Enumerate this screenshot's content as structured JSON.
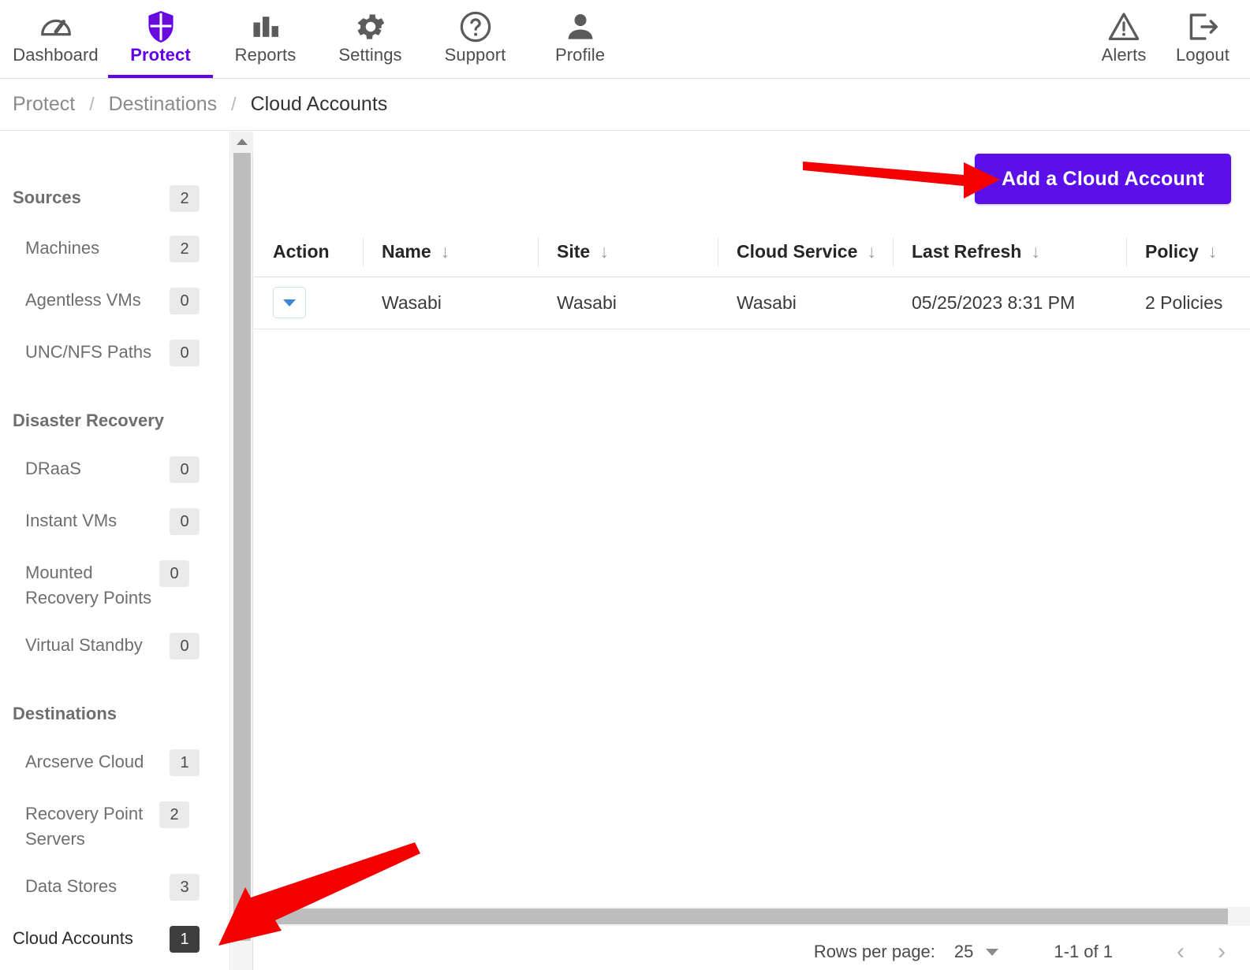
{
  "topnav": {
    "items": [
      {
        "label": "Dashboard",
        "icon": "gauge-icon",
        "active": false
      },
      {
        "label": "Protect",
        "icon": "shield-icon",
        "active": true
      },
      {
        "label": "Reports",
        "icon": "bar-chart-icon",
        "active": false
      },
      {
        "label": "Settings",
        "icon": "gear-icon",
        "active": false
      },
      {
        "label": "Support",
        "icon": "question-circle-icon",
        "active": false
      },
      {
        "label": "Profile",
        "icon": "person-icon",
        "active": false
      }
    ],
    "right_items": [
      {
        "label": "Alerts",
        "icon": "warning-triangle-icon"
      },
      {
        "label": "Logout",
        "icon": "logout-arrow-icon"
      }
    ],
    "active_color": "#6200ee"
  },
  "breadcrumb": {
    "items": [
      "Protect",
      "Destinations",
      "Cloud Accounts"
    ],
    "separator": "/",
    "current": "Cloud Accounts"
  },
  "sidebar": {
    "groups": [
      {
        "title": "Sources",
        "title_count": "2",
        "items": [
          {
            "label": "Machines",
            "count": "2",
            "selected": false
          },
          {
            "label": "Agentless VMs",
            "count": "0",
            "selected": false
          },
          {
            "label": "UNC/NFS Paths",
            "count": "0",
            "selected": false
          }
        ]
      },
      {
        "title": "Disaster Recovery",
        "title_count": "",
        "items": [
          {
            "label": "DRaaS",
            "count": "0",
            "selected": false
          },
          {
            "label": "Instant VMs",
            "count": "0",
            "selected": false
          },
          {
            "label": "Mounted Recovery Points",
            "count": "0",
            "selected": false
          },
          {
            "label": "Virtual Standby",
            "count": "0",
            "selected": false
          }
        ]
      },
      {
        "title": "Destinations",
        "title_count": "",
        "items": [
          {
            "label": "Arcserve Cloud",
            "count": "1",
            "selected": false
          },
          {
            "label": "Recovery Point Servers",
            "count": "2",
            "selected": false
          },
          {
            "label": "Data Stores",
            "count": "3",
            "selected": false
          },
          {
            "label": "Cloud Accounts",
            "count": "1",
            "selected": true
          }
        ]
      }
    ]
  },
  "main": {
    "add_button_label": "Add a Cloud Account",
    "add_button_color": "#5b10ea",
    "table": {
      "columns": [
        {
          "label": "Action",
          "sortable": false
        },
        {
          "label": "Name",
          "sortable": true,
          "sort_icon": "↓"
        },
        {
          "label": "Site",
          "sortable": true,
          "sort_icon": "↓"
        },
        {
          "label": "Cloud Service",
          "sortable": true,
          "sort_icon": "↓"
        },
        {
          "label": "Last Refresh",
          "sortable": true,
          "sort_icon": "↓"
        },
        {
          "label": "Policy",
          "sortable": true,
          "sort_icon": "↓"
        }
      ],
      "rows": [
        {
          "action": "row-action-dropdown",
          "name": "Wasabi",
          "site": "Wasabi",
          "cloud_service": "Wasabi",
          "last_refresh": "05/25/2023 8:31 PM",
          "policy": "2 Policies"
        }
      ]
    },
    "pagination": {
      "rows_per_page_label": "Rows per page:",
      "rows_per_page_value": "25",
      "range": "1-1 of 1",
      "prev_icon": "‹",
      "next_icon": "›"
    }
  },
  "annotations": {
    "arrow_color": "#f40000",
    "arrows": [
      {
        "name": "arrow-to-add-cloud-account",
        "points_to": "Add a Cloud Account"
      },
      {
        "name": "arrow-to-cloud-accounts-sidebar",
        "points_to": "Cloud Accounts"
      }
    ]
  }
}
